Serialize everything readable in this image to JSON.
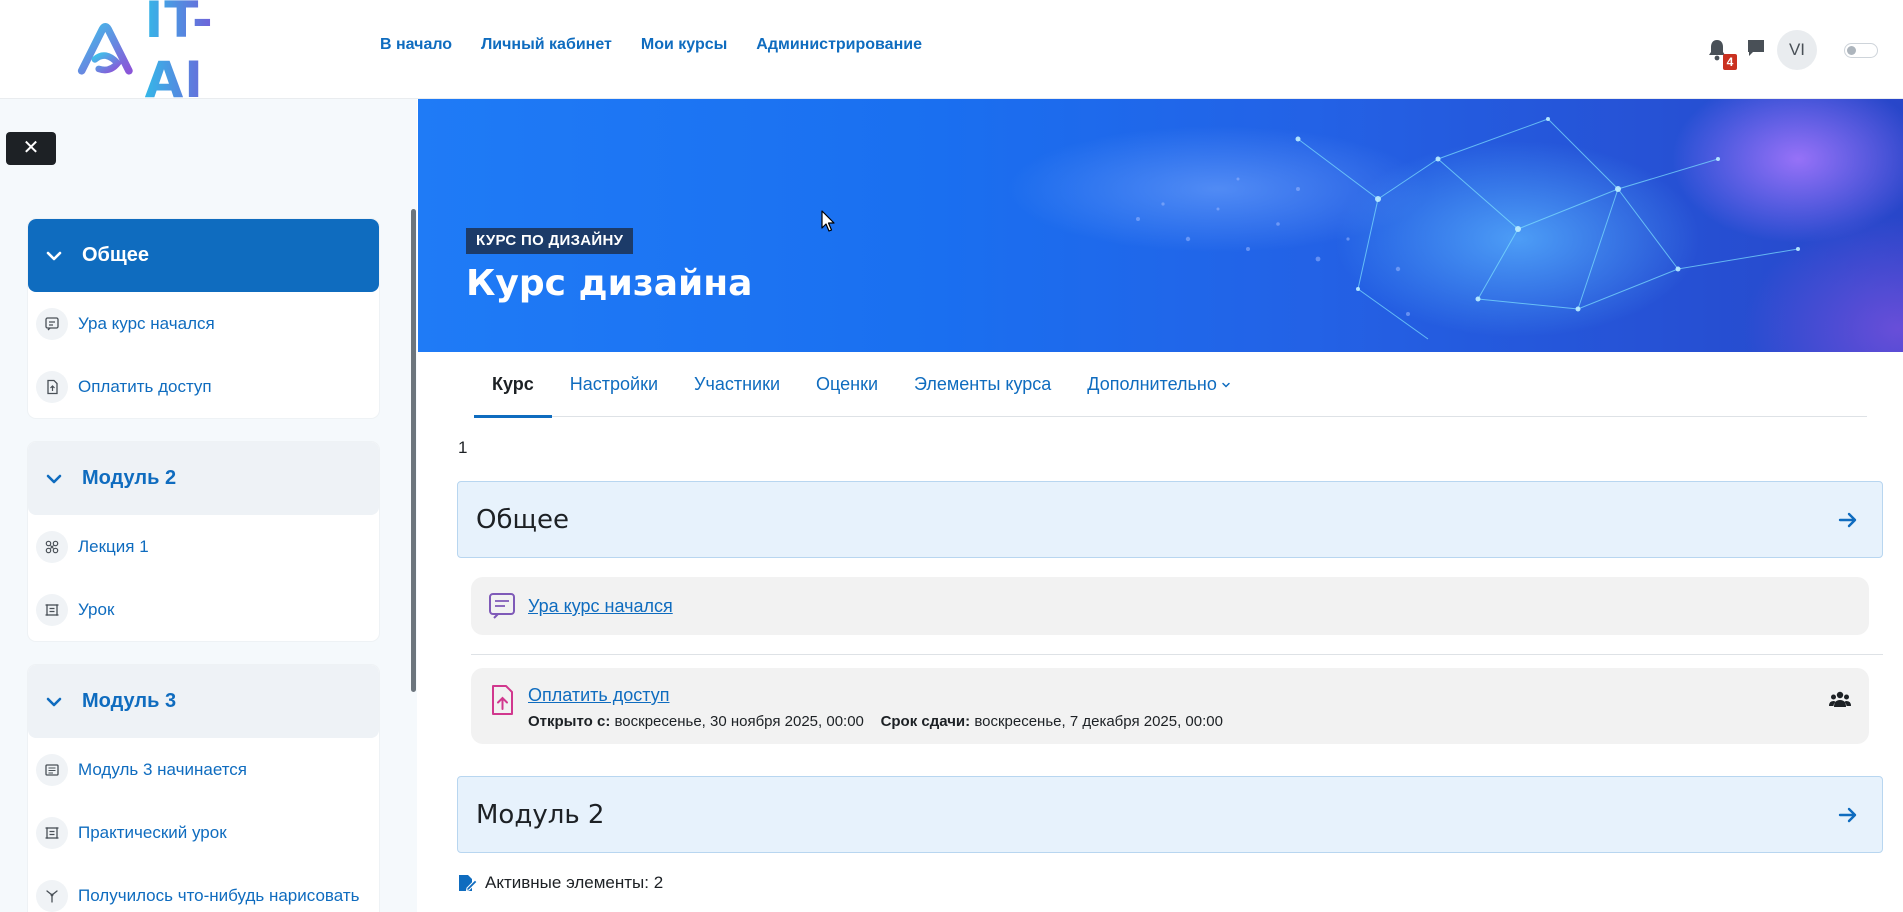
{
  "brand": {
    "logo_text": "IT-AI",
    "colors": {
      "primary": "#0f6cbf",
      "badge": "#ca3120"
    }
  },
  "primary_nav": [
    {
      "label": "В начало"
    },
    {
      "label": "Личный кабинет"
    },
    {
      "label": "Мои курсы"
    },
    {
      "label": "Администрирование"
    }
  ],
  "user_menu": {
    "notification_count": "4",
    "avatar_initials": "VI",
    "icons": [
      "bell-icon",
      "chat-icon"
    ]
  },
  "drawer": {
    "close_label": "✕",
    "sections": [
      {
        "title": "Общее",
        "active": true,
        "items": [
          {
            "label": "Ура курс начался",
            "icon": "forum-icon"
          },
          {
            "label": "Оплатить доступ",
            "icon": "assignment-icon"
          }
        ]
      },
      {
        "title": "Модуль 2",
        "active": false,
        "items": [
          {
            "label": "Лекция 1",
            "icon": "workshop-icon"
          },
          {
            "label": "Урок",
            "icon": "lesson-icon"
          }
        ]
      },
      {
        "title": "Модуль 3",
        "active": false,
        "items": [
          {
            "label": "Модуль 3 начинается",
            "icon": "page-icon"
          },
          {
            "label": "Практический урок",
            "icon": "lesson-icon"
          },
          {
            "label": "Получилось что-нибудь нарисовать",
            "icon": "choice-icon"
          }
        ]
      }
    ]
  },
  "header": {
    "tag": "КУРС ПО ДИЗАЙНУ",
    "title": "Курс дизайна"
  },
  "secondary_nav": [
    {
      "label": "Курс",
      "active": true
    },
    {
      "label": "Настройки"
    },
    {
      "label": "Участники"
    },
    {
      "label": "Оценки"
    },
    {
      "label": "Элементы курса"
    },
    {
      "label": "Дополнительно"
    }
  ],
  "content": {
    "page_number": "1",
    "sections": [
      {
        "title": "Общее"
      },
      {
        "title": "Модуль 2"
      }
    ],
    "activities": [
      {
        "name": "Ура курс начался",
        "icon": "forum-icon"
      },
      {
        "name": "Оплатить доступ",
        "icon": "assignment-icon",
        "opened_label": "Открыто с:",
        "opened_value": "воскресенье, 30 ноября 2025, 00:00",
        "due_label": "Срок сдачи:",
        "due_value": "воскресенье, 7 декабря 2025, 00:00"
      }
    ],
    "active_elements": "Активные элементы: 2"
  }
}
